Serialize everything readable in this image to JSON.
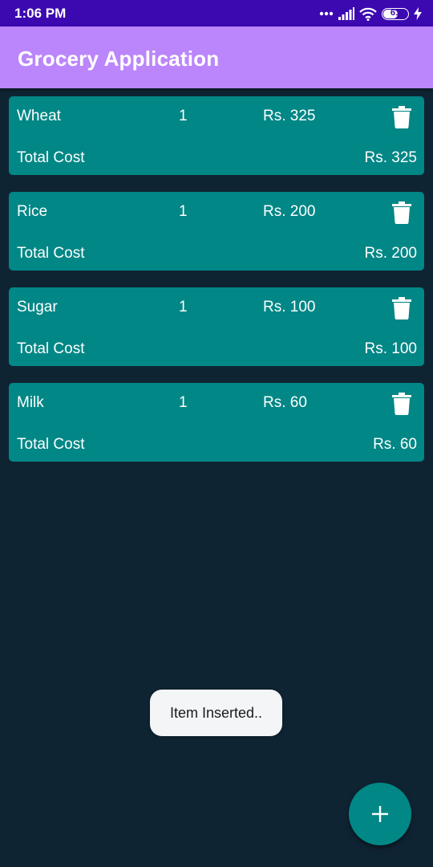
{
  "status_bar": {
    "time": "1:06 PM",
    "battery_level": "61",
    "battery_fraction": 0.61,
    "icons": [
      "dots-icon",
      "signal-icon",
      "wifi-icon",
      "battery-icon",
      "charging-icon"
    ]
  },
  "app_bar": {
    "title": "Grocery Application"
  },
  "items": [
    {
      "name": "Wheat",
      "quantity": "1",
      "rate": "Rs. 325",
      "total_label": "Total Cost",
      "total": "Rs. 325"
    },
    {
      "name": "Rice",
      "quantity": "1",
      "rate": "Rs. 200",
      "total_label": "Total Cost",
      "total": "Rs. 200"
    },
    {
      "name": "Sugar",
      "quantity": "1",
      "rate": "Rs. 100",
      "total_label": "Total Cost",
      "total": "Rs. 100"
    },
    {
      "name": "Milk",
      "quantity": "1",
      "rate": "Rs. 60",
      "total_label": "Total Cost",
      "total": "Rs. 60"
    }
  ],
  "toast": {
    "message": "Item Inserted.."
  },
  "fab": {
    "icon": "plus-icon"
  },
  "colors": {
    "status_bar": "#3c09b0",
    "app_bar": "#bb86fc",
    "background": "#0f2433",
    "card": "#018786",
    "fab": "#018786",
    "toast": "#f4f5f7"
  }
}
